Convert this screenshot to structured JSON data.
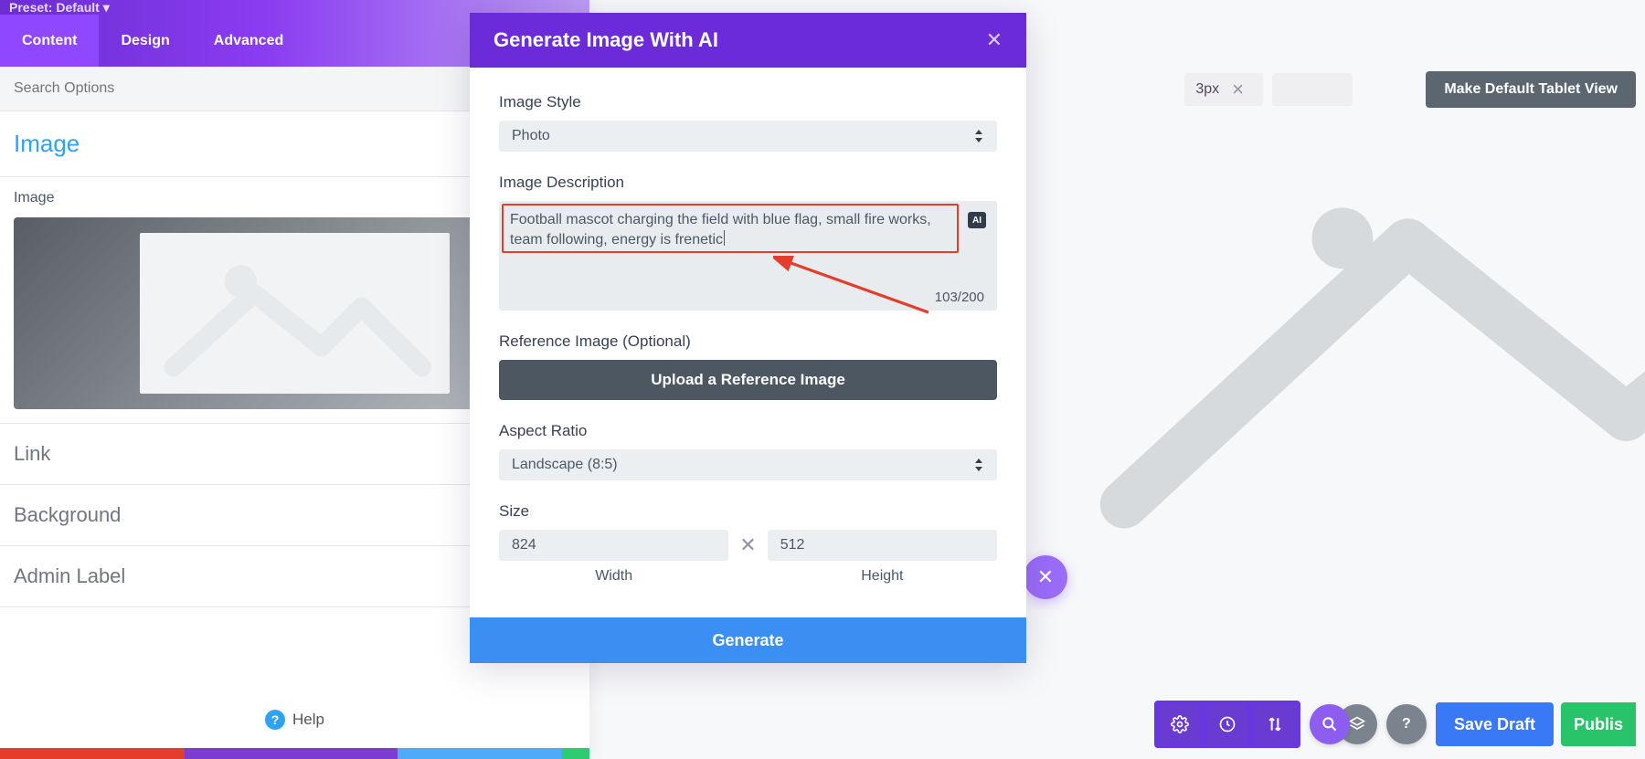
{
  "panel": {
    "preset_label": "Preset: Default ▾",
    "tabs": {
      "content": "Content",
      "design": "Design",
      "advanced": "Advanced"
    },
    "search_placeholder": "Search Options",
    "sections": {
      "image_title": "Image",
      "image_label": "Image",
      "link": "Link",
      "background": "Background",
      "admin_label": "Admin Label"
    },
    "help": "Help"
  },
  "toolbar": {
    "px_value": "3px",
    "make_default": "Make Default Tablet View"
  },
  "close_bubble": "✕",
  "modal": {
    "title": "Generate Image With AI",
    "image_style_label": "Image Style",
    "image_style_value": "Photo",
    "image_desc_label": "Image Description",
    "image_desc_value": "Football mascot charging the field with blue flag, small fire works, team following, energy is frenetic",
    "ai_badge": "AI",
    "char_count": "103/200",
    "ref_label": "Reference Image (Optional)",
    "upload_label": "Upload a Reference Image",
    "aspect_label": "Aspect Ratio",
    "aspect_value": "Landscape (8:5)",
    "size_label": "Size",
    "width_value": "824",
    "width_caption": "Width",
    "height_value": "512",
    "height_caption": "Height",
    "generate": "Generate"
  },
  "bottom": {
    "save_draft": "Save Draft",
    "publish": "Publis"
  }
}
